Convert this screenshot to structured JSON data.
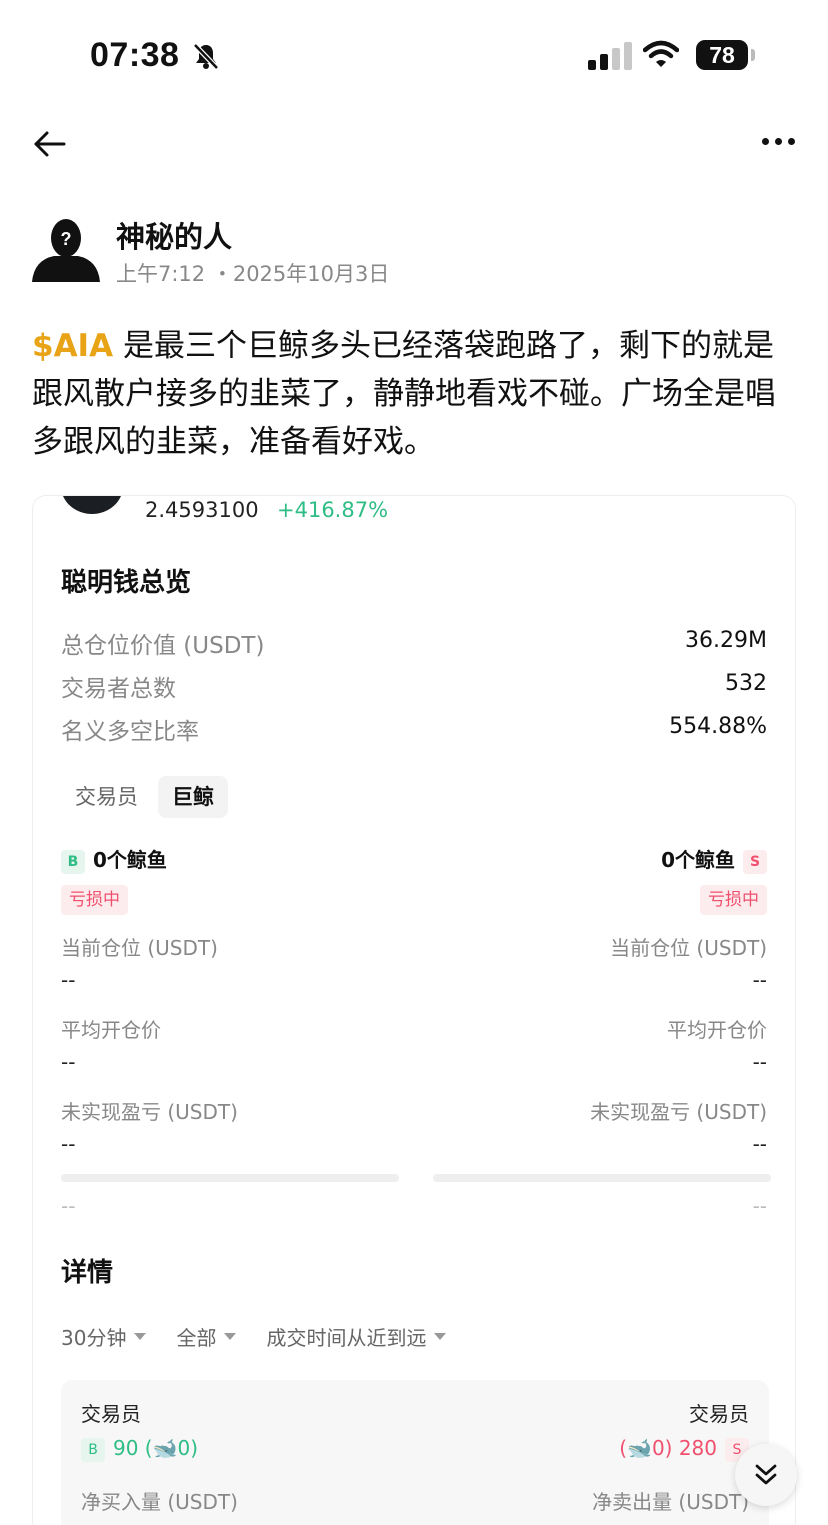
{
  "status_bar": {
    "time": "07:38",
    "battery": "78"
  },
  "author": {
    "name": "神秘的人",
    "time": "上午7:12 ・2025年10月3日"
  },
  "post": {
    "cashtag": "$AIA",
    "text": " 是最三个巨鲸多头已经落袋跑路了，剩下的就是跟风散户接多的韭菜了，静静地看戏不碰。广场全是唱多跟风的韭菜，准备看好戏。"
  },
  "card": {
    "price": "2.4593100",
    "change": "+416.87%",
    "overview_title": "聪明钱总览",
    "overview": [
      {
        "label": "总仓位价值 (USDT)",
        "value": "36.29M"
      },
      {
        "label": "交易者总数",
        "value": "532"
      },
      {
        "label": "名义多空比率",
        "value": "554.88%"
      }
    ],
    "tabs": [
      "交易员",
      "巨鲸"
    ],
    "active_tab": "巨鲸",
    "long": {
      "badge": "B",
      "count": "0个鲸鱼",
      "status": "亏损中"
    },
    "short": {
      "badge": "S",
      "count": "0个鲸鱼",
      "status": "亏损中"
    },
    "metrics": [
      {
        "label": "当前仓位 (USDT)",
        "long": "--",
        "short": "--"
      },
      {
        "label": "平均开仓价",
        "long": "--",
        "short": "--"
      },
      {
        "label": "未实现盈亏 (USDT)",
        "long": "--",
        "short": "--"
      }
    ],
    "bar_footer": {
      "long": "--",
      "short": "--"
    },
    "details_title": "详情",
    "filters": [
      "30分钟",
      "全部",
      "成交时间从近到远"
    ],
    "detail": {
      "left_label": "交易员",
      "right_label": "交易员",
      "buy_badge": "B",
      "buy_text": "90 (",
      "buy_whales": "0)",
      "sell_badge": "S",
      "sell_whales": "(",
      "sell_text": "0) 280",
      "net_buy_label": "净买入量 (USDT)",
      "net_sell_label": "净卖出量 (USDT)"
    }
  },
  "colors": {
    "cashtag": "#e8a317",
    "up": "#2ebd85",
    "down": "#f0506e"
  }
}
